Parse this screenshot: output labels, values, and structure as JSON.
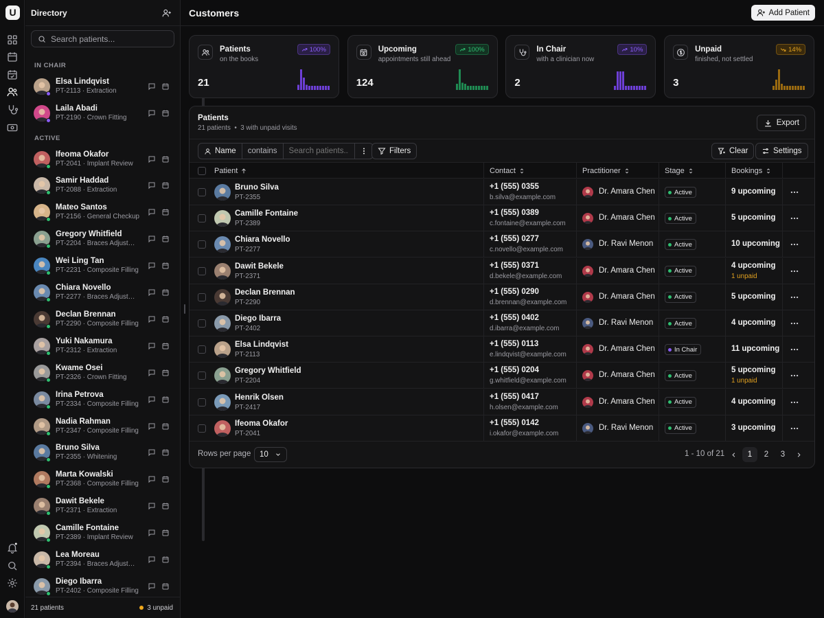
{
  "rail": {
    "logo": "U",
    "icons": [
      "dashboard-icon",
      "calendar-icon",
      "calendar-check-icon",
      "users-icon",
      "stethoscope-icon",
      "billing-icon"
    ],
    "bottom_icons": [
      "bell-icon",
      "search-icon",
      "settings-icon"
    ]
  },
  "directory": {
    "title": "Directory",
    "search_placeholder": "Search patients...",
    "section_in_chair": "IN CHAIR",
    "section_active": "ACTIVE",
    "in_chair": [
      {
        "name": "Elsa Lindqvist",
        "sub": "PT-2113 · Extraction",
        "color": "#b9a18a"
      },
      {
        "name": "Laila Abadi",
        "sub": "PT-2190 · Crown Fitting",
        "color": "#d0488a"
      }
    ],
    "active": [
      {
        "name": "Ifeoma Okafor",
        "sub": "PT-2041 · Implant Review",
        "color": "#c06060"
      },
      {
        "name": "Samir Haddad",
        "sub": "PT-2088 · Extraction",
        "color": "#c9b8a8"
      },
      {
        "name": "Mateo Santos",
        "sub": "PT-2156 · General Checkup",
        "color": "#d6b48a"
      },
      {
        "name": "Gregory Whitfield",
        "sub": "PT-2204 · Braces Adjustment",
        "color": "#8aa090"
      },
      {
        "name": "Wei Ling Tan",
        "sub": "PT-2231 · Composite Filling",
        "color": "#4a86c0"
      },
      {
        "name": "Chiara Novello",
        "sub": "PT-2277 · Braces Adjustment",
        "color": "#6a8ab0"
      },
      {
        "name": "Declan Brennan",
        "sub": "PT-2290 · Composite Filling",
        "color": "#4a3a34"
      },
      {
        "name": "Yuki Nakamura",
        "sub": "PT-2312 · Extraction",
        "color": "#a8a0a0"
      },
      {
        "name": "Kwame Osei",
        "sub": "PT-2326 · Crown Fitting",
        "color": "#9a9a9a"
      },
      {
        "name": "Irina Petrova",
        "sub": "PT-2334 · Composite Filling",
        "color": "#7a8aa0"
      },
      {
        "name": "Nadia Rahman",
        "sub": "PT-2347 · Composite Filling",
        "color": "#b09a86"
      },
      {
        "name": "Bruno Silva",
        "sub": "PT-2355 · Whitening",
        "color": "#5a7aa0"
      },
      {
        "name": "Marta Kowalski",
        "sub": "PT-2368 · Composite Filling",
        "color": "#b07a60"
      },
      {
        "name": "Dawit Bekele",
        "sub": "PT-2371 · Extraction",
        "color": "#9a8070"
      },
      {
        "name": "Camille Fontaine",
        "sub": "PT-2389 · Implant Review",
        "color": "#c0c8b0"
      },
      {
        "name": "Lea Moreau",
        "sub": "PT-2394 · Braces Adjustment",
        "color": "#c8b8a8"
      },
      {
        "name": "Diego Ibarra",
        "sub": "PT-2402 · Composite Filling",
        "color": "#8a9aaa"
      }
    ],
    "footer_count": "21 patients",
    "footer_unpaid": "3 unpaid"
  },
  "main": {
    "title": "Customers",
    "add_button": "Add Patient"
  },
  "stats": [
    {
      "title": "Patients",
      "sub": "on the books",
      "value": "21",
      "badge": "100%",
      "badge_color": "#8a5cf6",
      "badge_bg": "#2a1f45",
      "bar_color": "#6d3fd6",
      "icon": "users-icon",
      "bars": [
        0.25,
        1,
        0.6,
        0.25,
        0.2,
        0.2,
        0.2,
        0.2,
        0.2,
        0.2,
        0.2,
        0.2
      ]
    },
    {
      "title": "Upcoming",
      "sub": "appointments still ahead",
      "value": "124",
      "badge": "100%",
      "badge_color": "#2fbf71",
      "badge_bg": "#133222",
      "bar_color": "#1f8a52",
      "icon": "calendar-clock-icon",
      "bars": [
        0.3,
        1,
        0.35,
        0.3,
        0.2,
        0.2,
        0.2,
        0.2,
        0.2,
        0.2,
        0.2,
        0.2
      ]
    },
    {
      "title": "In Chair",
      "sub": "with a clinician now",
      "value": "2",
      "badge": "10%",
      "badge_color": "#8a5cf6",
      "badge_bg": "#2a1f45",
      "bar_color": "#6d3fd6",
      "icon": "stethoscope-icon",
      "bars": [
        0.2,
        0.9,
        0.9,
        0.9,
        0.2,
        0.2,
        0.2,
        0.2,
        0.2,
        0.2,
        0.2,
        0.2
      ]
    },
    {
      "title": "Unpaid",
      "sub": "finished, not settled",
      "value": "3",
      "badge": "14%",
      "badge_color": "#e0a020",
      "badge_bg": "#3a2a0c",
      "bar_color": "#9a6a10",
      "icon": "dollar-icon",
      "bars": [
        0.2,
        0.5,
        1,
        0.3,
        0.2,
        0.2,
        0.2,
        0.2,
        0.2,
        0.2,
        0.2,
        0.2
      ],
      "trend_down": true
    }
  ],
  "panel": {
    "title": "Patients",
    "subtitle_count": "21 patients",
    "subtitle_unpaid": "3 with unpaid visits",
    "export": "Export",
    "filter_field": "Name",
    "filter_op": "contains",
    "filter_placeholder": "Search patients...",
    "filters_button": "Filters",
    "clear_button": "Clear",
    "settings_button": "Settings",
    "columns": {
      "patient": "Patient",
      "contact": "Contact",
      "practitioner": "Practitioner",
      "stage": "Stage",
      "bookings": "Bookings"
    },
    "rows": [
      {
        "name": "Bruno Silva",
        "id": "PT-2355",
        "phone": "+1 (555) 0355",
        "email": "b.silva@example.com",
        "doctor": "Dr. Amara Chen",
        "stage": "Active",
        "bookings": "9 upcoming",
        "unpaid": "",
        "color": "#5a7aa0"
      },
      {
        "name": "Camille Fontaine",
        "id": "PT-2389",
        "phone": "+1 (555) 0389",
        "email": "c.fontaine@example.com",
        "doctor": "Dr. Amara Chen",
        "stage": "Active",
        "bookings": "5 upcoming",
        "unpaid": "",
        "color": "#c0c8b0"
      },
      {
        "name": "Chiara Novello",
        "id": "PT-2277",
        "phone": "+1 (555) 0277",
        "email": "c.novello@example.com",
        "doctor": "Dr. Ravi Menon",
        "stage": "Active",
        "bookings": "10 upcoming",
        "unpaid": "",
        "color": "#6a8ab0"
      },
      {
        "name": "Dawit Bekele",
        "id": "PT-2371",
        "phone": "+1 (555) 0371",
        "email": "d.bekele@example.com",
        "doctor": "Dr. Amara Chen",
        "stage": "Active",
        "bookings": "4 upcoming",
        "unpaid": "1 unpaid",
        "color": "#9a8070"
      },
      {
        "name": "Declan Brennan",
        "id": "PT-2290",
        "phone": "+1 (555) 0290",
        "email": "d.brennan@example.com",
        "doctor": "Dr. Amara Chen",
        "stage": "Active",
        "bookings": "5 upcoming",
        "unpaid": "",
        "color": "#4a3a34"
      },
      {
        "name": "Diego Ibarra",
        "id": "PT-2402",
        "phone": "+1 (555) 0402",
        "email": "d.ibarra@example.com",
        "doctor": "Dr. Ravi Menon",
        "stage": "Active",
        "bookings": "4 upcoming",
        "unpaid": "",
        "color": "#8a9aaa"
      },
      {
        "name": "Elsa Lindqvist",
        "id": "PT-2113",
        "phone": "+1 (555) 0113",
        "email": "e.lindqvist@example.com",
        "doctor": "Dr. Amara Chen",
        "stage": "In Chair",
        "bookings": "11 upcoming",
        "unpaid": "",
        "color": "#b9a18a"
      },
      {
        "name": "Gregory Whitfield",
        "id": "PT-2204",
        "phone": "+1 (555) 0204",
        "email": "g.whitfield@example.com",
        "doctor": "Dr. Amara Chen",
        "stage": "Active",
        "bookings": "5 upcoming",
        "unpaid": "1 unpaid",
        "color": "#8aa090"
      },
      {
        "name": "Henrik Olsen",
        "id": "PT-2417",
        "phone": "+1 (555) 0417",
        "email": "h.olsen@example.com",
        "doctor": "Dr. Amara Chen",
        "stage": "Active",
        "bookings": "4 upcoming",
        "unpaid": "",
        "color": "#7a9ab8"
      },
      {
        "name": "Ifeoma Okafor",
        "id": "PT-2041",
        "phone": "+1 (555) 0142",
        "email": "i.okafor@example.com",
        "doctor": "Dr. Ravi Menon",
        "stage": "Active",
        "bookings": "3 upcoming",
        "unpaid": "",
        "color": "#c06060"
      }
    ],
    "rows_per_page_label": "Rows per page",
    "rows_per_page": "10",
    "range": "1 - 10 of 21",
    "pages": [
      "1",
      "2",
      "3"
    ]
  }
}
